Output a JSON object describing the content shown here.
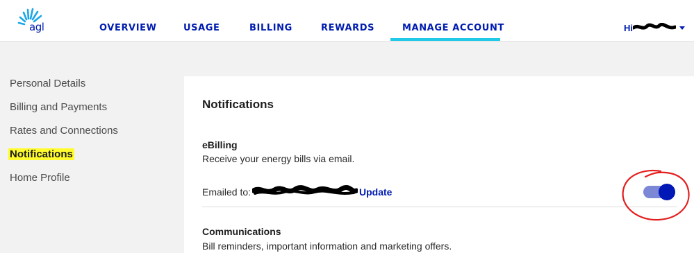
{
  "brand": {
    "logo_text": "agl"
  },
  "nav": {
    "items": [
      {
        "label": "OVERVIEW"
      },
      {
        "label": "USAGE"
      },
      {
        "label": "BILLING"
      },
      {
        "label": "REWARDS"
      },
      {
        "label": "MANAGE ACCOUNT",
        "active": true
      }
    ],
    "user_greeting": "Hi",
    "accent_color": "#20c9e8",
    "brand_color": "#001cb0"
  },
  "sidebar": {
    "items": [
      {
        "label": "Personal Details"
      },
      {
        "label": "Billing and Payments"
      },
      {
        "label": "Rates and Connections"
      },
      {
        "label": "Notifications",
        "active": true
      },
      {
        "label": "Home Profile"
      }
    ],
    "highlight_color": "#fffb2e"
  },
  "panel": {
    "title": "Notifications",
    "ebilling": {
      "title": "eBilling",
      "description": "Receive your energy bills via email.",
      "emailed_label": "Emailed to:",
      "update_label": "Update",
      "toggle_on": true
    },
    "communications": {
      "title": "Communications",
      "description": "Bill reminders, important information and marketing offers."
    }
  },
  "icons": {
    "logo": "agl-sun-logo-icon",
    "caret": "caret-down-icon"
  }
}
